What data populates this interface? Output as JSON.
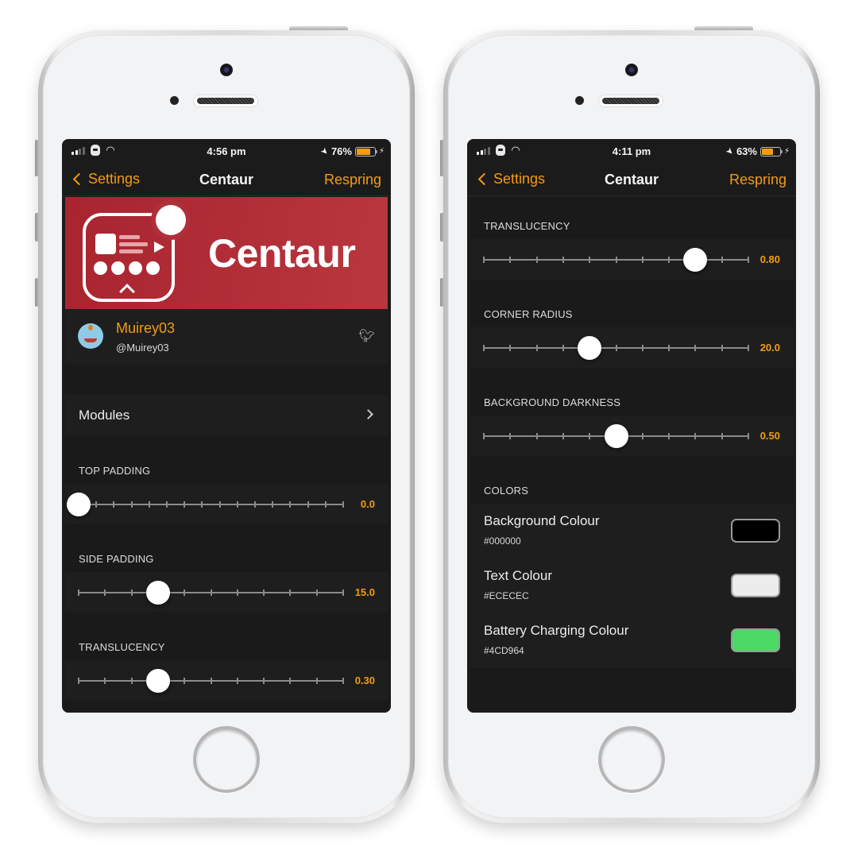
{
  "accent_color": "#F39C12",
  "phones": [
    {
      "status": {
        "time": "4:56 pm",
        "battery_percent": "76%",
        "battery_level": 0.76
      },
      "nav": {
        "back_label": "Settings",
        "title": "Centaur",
        "action_label": "Respring"
      },
      "banner": {
        "title": "Centaur"
      },
      "profile": {
        "name": "Muirey03",
        "handle": "@Muirey03"
      },
      "modules_label": "Modules",
      "sliders": [
        {
          "label": "TOP PADDING",
          "value_text": "0.0",
          "position": 0.0,
          "ticks": 16
        },
        {
          "label": "SIDE PADDING",
          "value_text": "15.0",
          "position": 0.3,
          "ticks": 11
        },
        {
          "label": "TRANSLUCENCY",
          "value_text": "0.30",
          "position": 0.3,
          "ticks": 11
        }
      ]
    },
    {
      "status": {
        "time": "4:11 pm",
        "battery_percent": "63%",
        "battery_level": 0.63
      },
      "nav": {
        "back_label": "Settings",
        "title": "Centaur",
        "action_label": "Respring"
      },
      "sliders": [
        {
          "label": "TRANSLUCENCY",
          "value_text": "0.80",
          "position": 0.8,
          "ticks": 11
        },
        {
          "label": "CORNER RADIUS",
          "value_text": "20.0",
          "position": 0.4,
          "ticks": 11
        },
        {
          "label": "BACKGROUND DARKNESS",
          "value_text": "0.50",
          "position": 0.5,
          "ticks": 11
        }
      ],
      "colors_header": "COLORS",
      "colors": [
        {
          "label": "Background Colour",
          "hex": "#000000",
          "swatch": "#000000"
        },
        {
          "label": "Text Colour",
          "hex": "#ECECEC",
          "swatch": "#ECECEC"
        },
        {
          "label": "Battery Charging Colour",
          "hex": "#4CD964",
          "swatch": "#4CD964"
        }
      ]
    }
  ]
}
